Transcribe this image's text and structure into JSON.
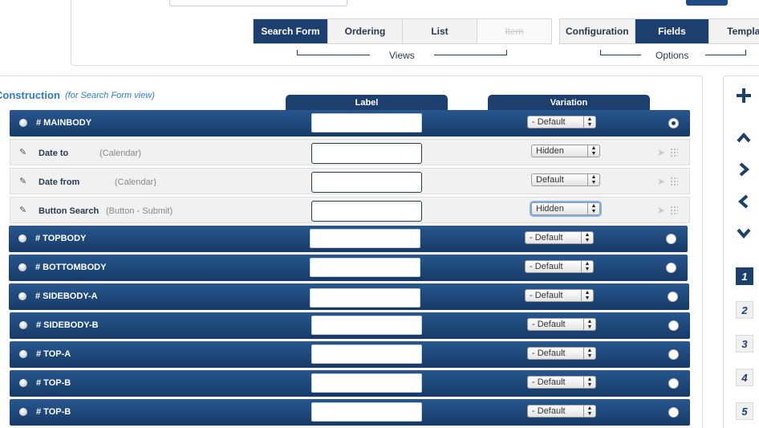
{
  "views": {
    "label": "Views",
    "tabs": [
      {
        "label": "Search Form",
        "state": "active"
      },
      {
        "label": "Ordering",
        "state": "normal"
      },
      {
        "label": "List",
        "state": "normal"
      },
      {
        "label": "Item",
        "state": "disabled"
      }
    ]
  },
  "options": {
    "label": "Options",
    "tabs": [
      {
        "label": "Configuration",
        "state": "normal"
      },
      {
        "label": "Fields",
        "state": "active"
      },
      {
        "label": "Templat",
        "state": "normal"
      }
    ]
  },
  "construction": {
    "title": "Construction",
    "subtitle": "(for Search Form view)",
    "columns": {
      "label": "Label",
      "variation": "Variation"
    }
  },
  "rows": {
    "mainbody": {
      "name": "# MAINBODY",
      "variation": "- Default",
      "selected": true
    },
    "date_to": {
      "name": "Date to",
      "type": "(Calendar)",
      "variation": "Hidden"
    },
    "date_from": {
      "name": "Date from",
      "type": "(Calendar)",
      "variation": "Default"
    },
    "button_search": {
      "name": "Button Search",
      "type": "(Button - Submit)",
      "variation": "Hidden"
    },
    "topbody": {
      "name": "# TOPBODY",
      "variation": "- Default"
    },
    "bottombody": {
      "name": "# BOTTOMBODY",
      "variation": "- Default"
    },
    "sidebody_a": {
      "name": "# SIDEBODY-A",
      "variation": "- Default"
    },
    "sidebody_b": {
      "name": "# SIDEBODY-B",
      "variation": "- Default"
    },
    "top_a": {
      "name": "# TOP-A",
      "variation": "- Default"
    },
    "top_b": {
      "name": "# TOP-B",
      "variation": "- Default"
    },
    "top_b_2": {
      "name": "# TOP-B",
      "variation": "- Default"
    }
  },
  "sidebar": {
    "icons": [
      "plus-icon",
      "chevron-up-icon",
      "chevron-right-icon",
      "chevron-left-icon",
      "chevron-down-icon"
    ],
    "pages": [
      "1",
      "2",
      "3",
      "4",
      "5"
    ],
    "active_page": "1"
  },
  "colors": {
    "accent": "#1c3f6e",
    "link": "#2f7bbf"
  }
}
